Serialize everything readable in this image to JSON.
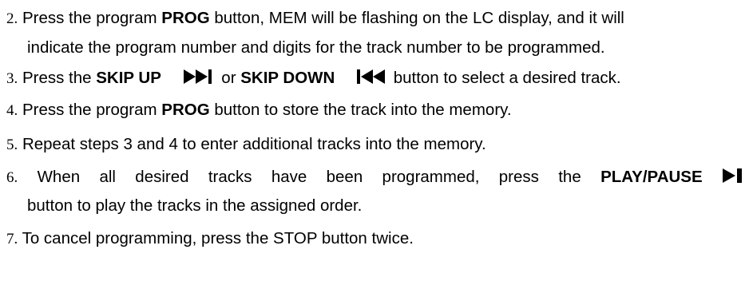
{
  "steps": [
    {
      "number": "2.",
      "parts": [
        "Press the program ",
        "PROG",
        " button, MEM will be flashing on the LC display, and it will"
      ],
      "continuation": "indicate the program number and digits for the track number to be programmed."
    },
    {
      "number": "3.",
      "parts": [
        "Press the ",
        "SKIP UP",
        " or ",
        "SKIP DOWN",
        " button to select a desired track."
      ],
      "icons": [
        "skip-up-icon",
        "skip-down-icon"
      ]
    },
    {
      "number": "4.",
      "parts": [
        "Press the program ",
        "PROG",
        " button to store the track into the memory."
      ]
    },
    {
      "number": "5.",
      "text": "Repeat steps 3 and 4 to enter additional tracks into the memory."
    },
    {
      "number": "6.",
      "parts": [
        "When all desired tracks have been programmed, press the ",
        "PLAY/PAUSE"
      ],
      "continuation": "button to play the tracks in the assigned order.",
      "icons": [
        "play-pause-icon"
      ]
    },
    {
      "number": "7.",
      "text": "To cancel programming, press the STOP button twice."
    }
  ]
}
